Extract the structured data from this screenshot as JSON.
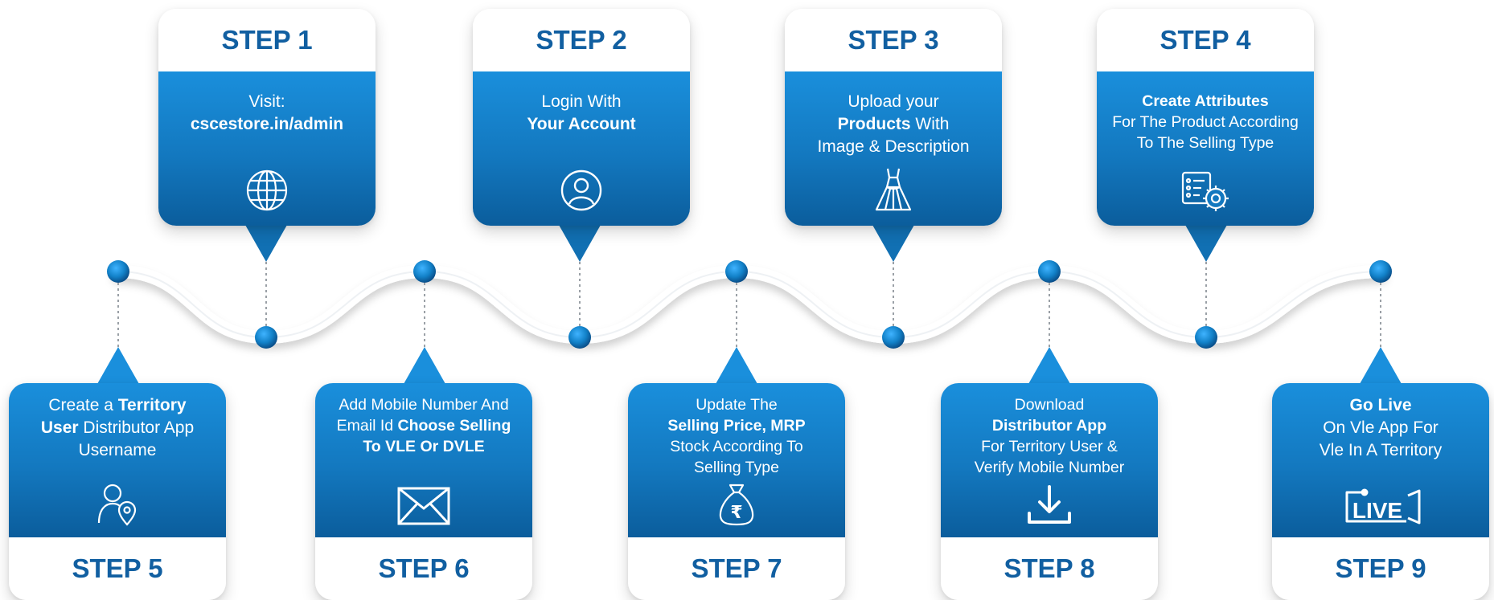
{
  "steps": [
    {
      "label": "STEP 1",
      "icon": "globe-icon",
      "lines": [
        [
          {
            "t": "Visit:",
            "b": false
          }
        ],
        [
          {
            "t": "cscestore.in/admin",
            "b": true
          }
        ]
      ]
    },
    {
      "label": "STEP 2",
      "icon": "user-circle-icon",
      "lines": [
        [
          {
            "t": "Login With",
            "b": false
          }
        ],
        [
          {
            "t": "Your Account",
            "b": true
          }
        ]
      ]
    },
    {
      "label": "STEP 3",
      "icon": "dress-icon",
      "lines": [
        [
          {
            "t": "Upload your",
            "b": false
          }
        ],
        [
          {
            "t": "Products",
            "b": true
          },
          {
            "t": " With",
            "b": false
          }
        ],
        [
          {
            "t": "Image &  Description",
            "b": false
          }
        ]
      ]
    },
    {
      "label": "STEP 4",
      "icon": "settings-list-icon",
      "lines": [
        [
          {
            "t": "Create Attributes",
            "b": true
          }
        ],
        [
          {
            "t": "For The Product According",
            "b": false
          }
        ],
        [
          {
            "t": "To The Selling Type",
            "b": false
          }
        ]
      ]
    },
    {
      "label": "STEP 5",
      "icon": "user-location-icon",
      "lines": [
        [
          {
            "t": "Create a ",
            "b": false
          },
          {
            "t": "Territory",
            "b": true
          }
        ],
        [
          {
            "t": "User",
            "b": true
          },
          {
            "t": " Distributor App",
            "b": false
          }
        ],
        [
          {
            "t": "Username",
            "b": false
          }
        ]
      ]
    },
    {
      "label": "STEP 6",
      "icon": "envelope-icon",
      "lines": [
        [
          {
            "t": "Add Mobile Number And",
            "b": false
          }
        ],
        [
          {
            "t": "Email Id ",
            "b": false
          },
          {
            "t": "Choose Selling",
            "b": true
          }
        ],
        [
          {
            "t": "To VLE Or DVLE",
            "b": true
          }
        ]
      ]
    },
    {
      "label": "STEP 7",
      "icon": "money-bag-icon",
      "lines": [
        [
          {
            "t": "Update The",
            "b": false
          }
        ],
        [
          {
            "t": "Selling Price, MRP",
            "b": true
          }
        ],
        [
          {
            "t": "Stock According To",
            "b": false
          }
        ],
        [
          {
            "t": "Selling Type",
            "b": false
          }
        ]
      ]
    },
    {
      "label": "STEP 8",
      "icon": "download-icon",
      "lines": [
        [
          {
            "t": "Download",
            "b": false
          }
        ],
        [
          {
            "t": "Distributor App",
            "b": true
          }
        ],
        [
          {
            "t": "For Territory User &",
            "b": false
          }
        ],
        [
          {
            "t": "Verify Mobile Number",
            "b": false
          }
        ]
      ]
    },
    {
      "label": "STEP 9",
      "icon": "live-icon",
      "lines": [
        [
          {
            "t": "Go Live",
            "b": true
          }
        ],
        [
          {
            "t": "On Vle App For",
            "b": false
          }
        ],
        [
          {
            "t": "Vle In A Territory",
            "b": false
          }
        ]
      ]
    }
  ],
  "icon_text": {
    "live": "LIVE",
    "rupee": "₹"
  },
  "colors": {
    "label": "#115fa1",
    "card_top": "#1a8fdc",
    "card_bottom": "#0b5d9c",
    "dot": "#1281c8"
  }
}
